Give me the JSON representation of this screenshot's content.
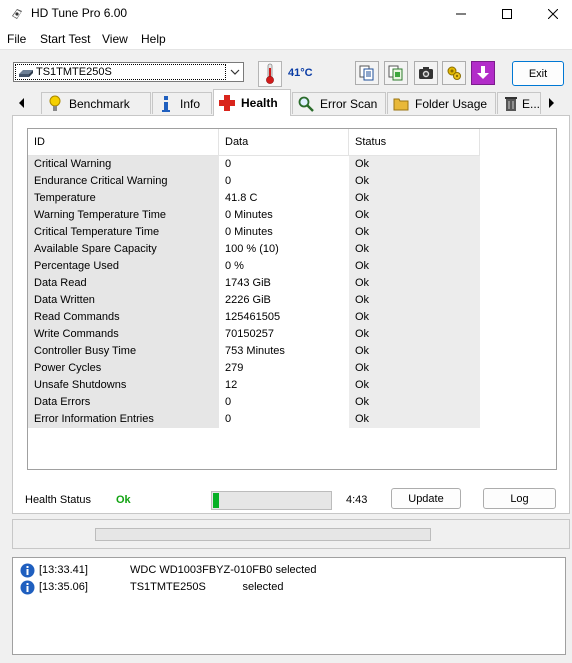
{
  "window": {
    "title": "HD Tune Pro 6.00"
  },
  "menu": [
    "File",
    "Start Test",
    "View",
    "Help"
  ],
  "toolbar": {
    "drive": "TS1TMTE250S",
    "temperature": "41°C",
    "exit_label": "Exit",
    "tool_icons": [
      "copy-info-icon",
      "copy-screenshot-icon",
      "camera-icon",
      "options-icon",
      "save-icon"
    ]
  },
  "tabs": [
    {
      "label": "Benchmark",
      "icon": "light-bulb-icon"
    },
    {
      "label": "Info",
      "icon": "info-icon"
    },
    {
      "label": "Health",
      "icon": "health-plus-icon",
      "active": true
    },
    {
      "label": "Error Scan",
      "icon": "magnifier-icon"
    },
    {
      "label": "Folder Usage",
      "icon": "folder-icon"
    },
    {
      "label": "E...",
      "icon": "trash-icon"
    }
  ],
  "health_table": {
    "columns": [
      "ID",
      "Data",
      "Status"
    ],
    "rows": [
      {
        "id": "Critical Warning",
        "data": "0",
        "status": "Ok"
      },
      {
        "id": "Endurance Critical Warning",
        "data": "0",
        "status": "Ok"
      },
      {
        "id": "Temperature",
        "data": "41.8 C",
        "status": "Ok"
      },
      {
        "id": "Warning Temperature Time",
        "data": "0 Minutes",
        "status": "Ok"
      },
      {
        "id": "Critical Temperature Time",
        "data": "0 Minutes",
        "status": "Ok"
      },
      {
        "id": "Available Spare Capacity",
        "data": "100 % (10)",
        "status": "Ok"
      },
      {
        "id": "Percentage Used",
        "data": "0 %",
        "status": "Ok"
      },
      {
        "id": "Data Read",
        "data": "1743 GiB",
        "status": "Ok"
      },
      {
        "id": "Data Written",
        "data": "2226 GiB",
        "status": "Ok"
      },
      {
        "id": "Read Commands",
        "data": "125461505",
        "status": "Ok"
      },
      {
        "id": "Write Commands",
        "data": "70150257",
        "status": "Ok"
      },
      {
        "id": "Controller Busy Time",
        "data": "753 Minutes",
        "status": "Ok"
      },
      {
        "id": "Power Cycles",
        "data": "279",
        "status": "Ok"
      },
      {
        "id": "Unsafe Shutdowns",
        "data": "12",
        "status": "Ok"
      },
      {
        "id": "Data Errors",
        "data": "0",
        "status": "Ok"
      },
      {
        "id": "Error Information Entries",
        "data": "0",
        "status": "Ok"
      }
    ]
  },
  "health_status": {
    "label": "Health Status",
    "value": "Ok",
    "progress_fraction": 0.05,
    "time": "4:43",
    "update_label": "Update",
    "log_label": "Log"
  },
  "colors": {
    "ok_green": "#12a312",
    "temp_blue": "#0a3ca5",
    "progress_green": "#06b025",
    "accent": "#0078d4"
  },
  "log": [
    {
      "time": "[13:33.41]",
      "message": "WDC WD1003FBYZ-010FB0 selected"
    },
    {
      "time": "[13:35.06]",
      "message": "TS1TMTE250S            selected"
    }
  ]
}
